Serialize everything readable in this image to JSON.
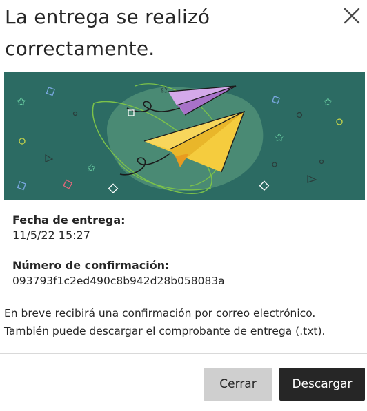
{
  "dialog": {
    "title": "La entrega se realizó correctamente.",
    "close_icon": "close-icon"
  },
  "banner": {
    "icon": "paper-plane-illustration",
    "colors": {
      "background": "#2c6b63",
      "blob": "#4a8a74",
      "plane_yellow": "#f5cc3e",
      "plane_purple": "#c58fe0",
      "accent_green": "#8fd14f"
    }
  },
  "submission": {
    "date_label": "Fecha de entrega:",
    "date_value": "11/5/22 15:27",
    "confirmation_label": "Número de confirmación:",
    "confirmation_value": "093793f1c2ed490c8b942d28b058083a"
  },
  "message": {
    "line1": "En breve recibirá una confirmación por correo electrónico.",
    "line2": "También puede descargar el comprobante de entrega (.txt)."
  },
  "footer": {
    "close_label": "Cerrar",
    "download_label": "Descargar"
  },
  "colors": {
    "primary_button": "#262626",
    "secondary_button": "#cfcfcf"
  }
}
